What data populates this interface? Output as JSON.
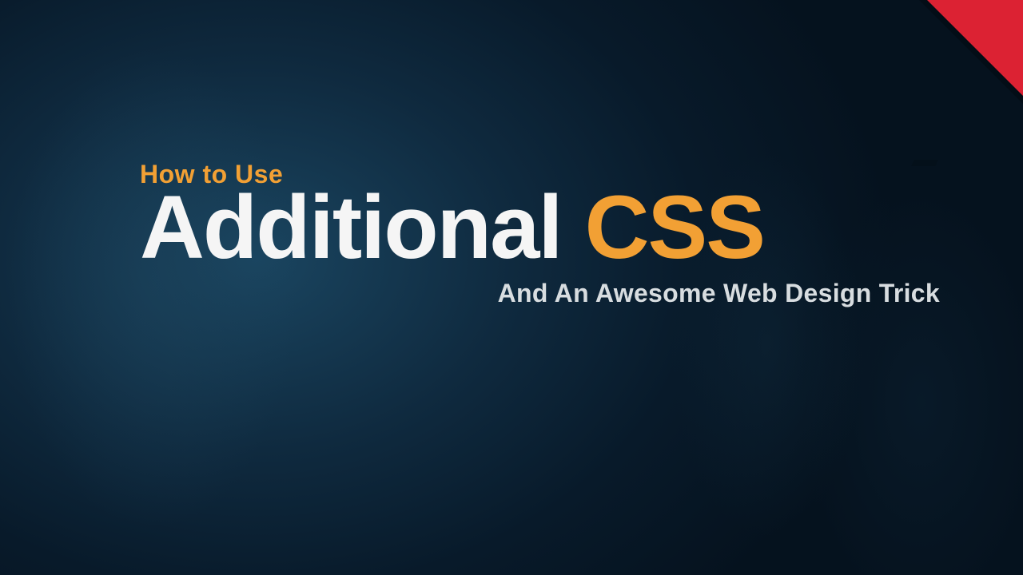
{
  "eyebrow": "How to Use",
  "headline": {
    "part1": "Additional",
    "part2": "CSS"
  },
  "subline": "And An Awesome Web Design Trick",
  "colors": {
    "accent": "#f2a034",
    "ribbon": "#dc2233",
    "text_light": "#f5f5f5",
    "text_muted": "#d8dde0"
  }
}
